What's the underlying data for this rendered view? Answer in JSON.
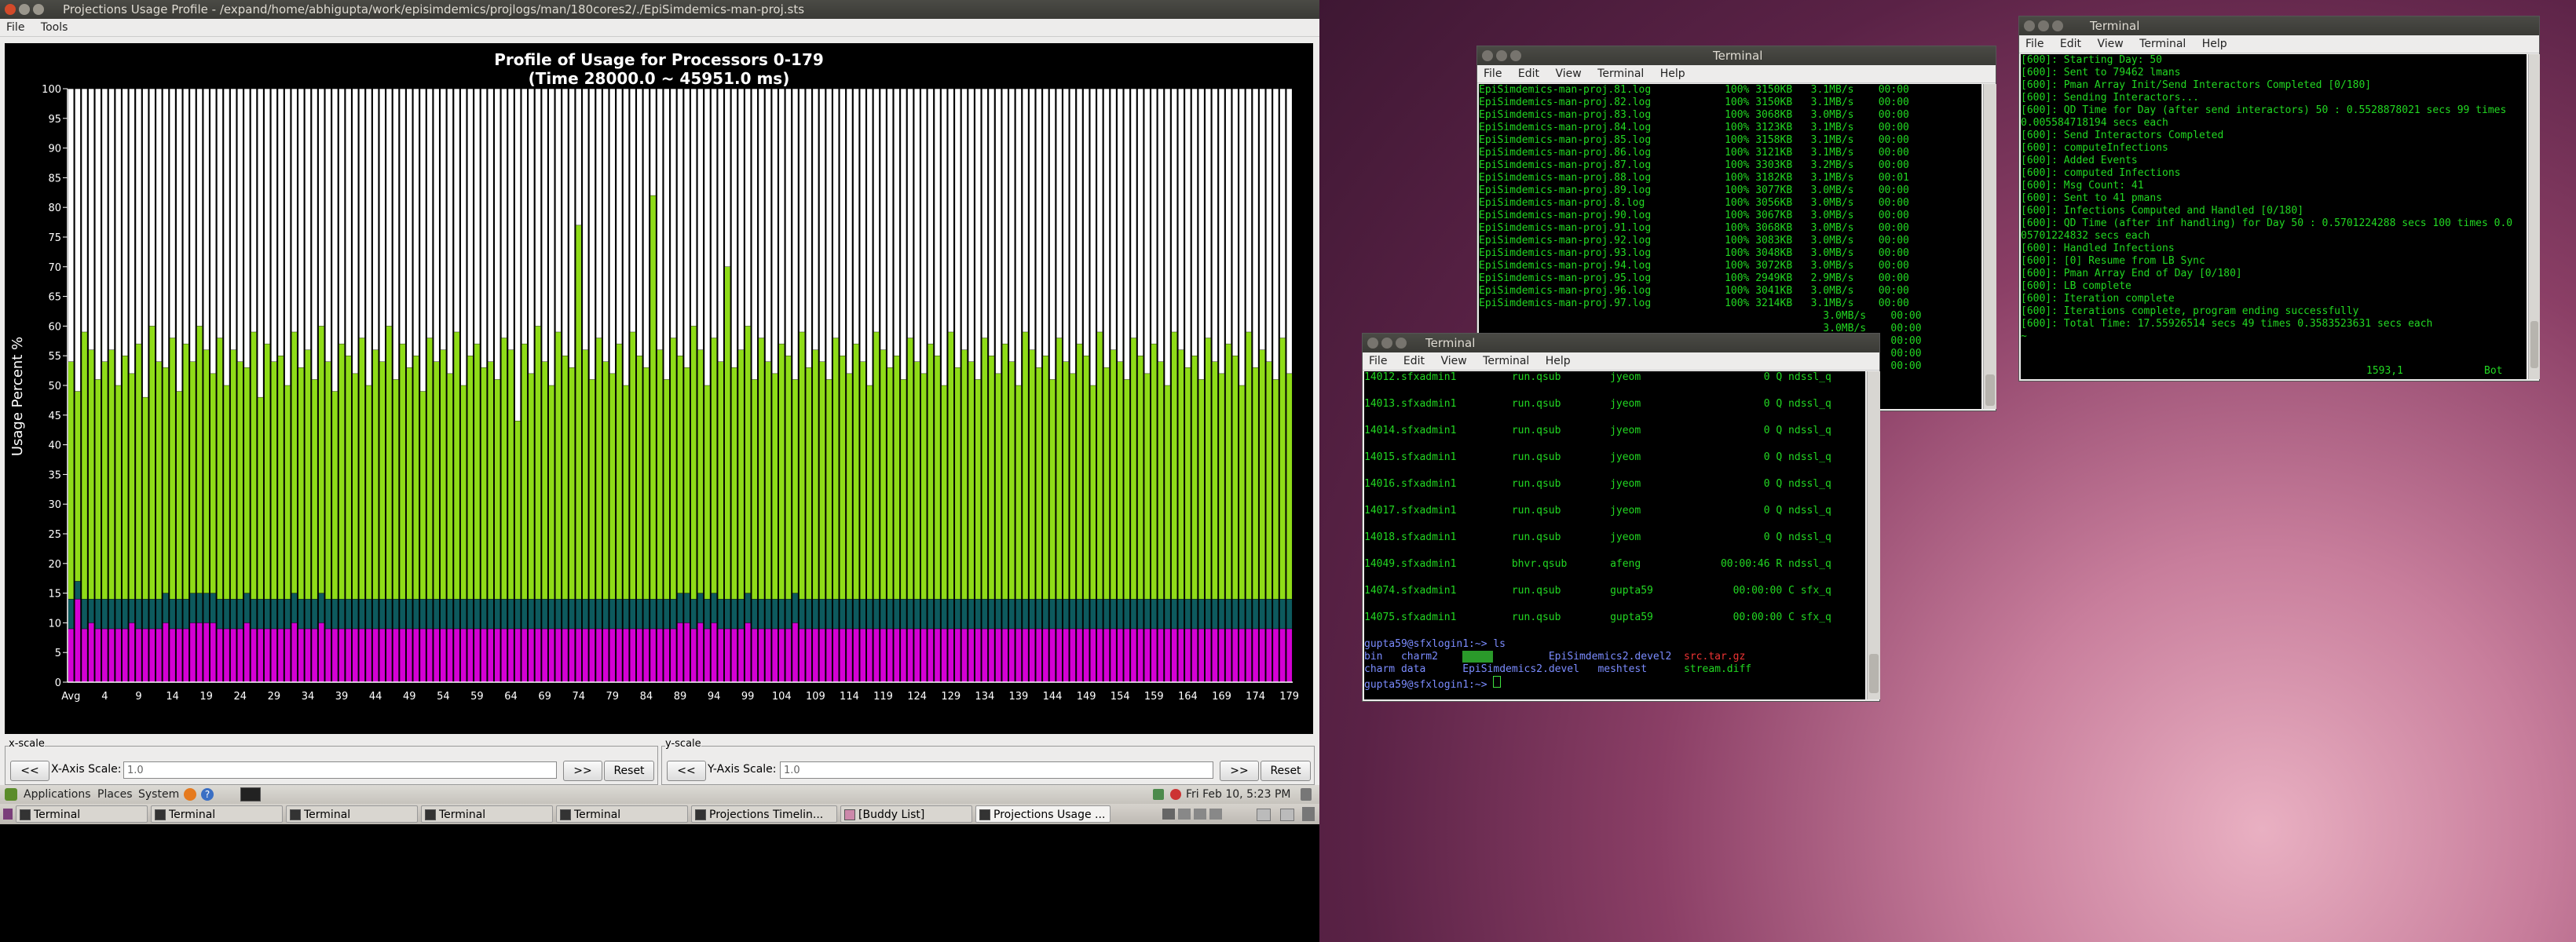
{
  "projections": {
    "title": "Projections Usage Profile - /expand/home/abhigupta/work/episimdemics/projlogs/man/180cores2/./EpiSimdemics-man-proj.sts",
    "menu": [
      "File",
      "Tools"
    ],
    "xscale": {
      "legend": "x-scale",
      "back": "<<",
      "label": "X-Axis Scale:",
      "value": "1.0",
      "fwd": ">>",
      "reset": "Reset"
    },
    "yscale": {
      "legend": "y-scale",
      "back": "<<",
      "label": "Y-Axis Scale:",
      "value": "1.0",
      "fwd": ">>",
      "reset": "Reset"
    }
  },
  "chart_data": {
    "type": "bar",
    "title": "Profile of Usage for Processors 0-179",
    "subtitle": "(Time 28000.0 ~ 45951.0 ms)",
    "ylabel": "Usage Percent %",
    "ylim": [
      0,
      100
    ],
    "yticks": [
      0,
      5,
      10,
      15,
      20,
      25,
      30,
      35,
      40,
      45,
      50,
      55,
      60,
      65,
      70,
      75,
      80,
      85,
      90,
      95,
      100
    ],
    "xtick_labels": [
      "Avg",
      "4",
      "9",
      "14",
      "19",
      "24",
      "29",
      "34",
      "39",
      "44",
      "49",
      "54",
      "59",
      "64",
      "69",
      "74",
      "79",
      "84",
      "89",
      "94",
      "99",
      "104",
      "109",
      "114",
      "119",
      "124",
      "129",
      "134",
      "139",
      "144",
      "149",
      "154",
      "159",
      "164",
      "169",
      "174",
      "179"
    ],
    "categories": [
      "Avg",
      "0",
      "1",
      "2",
      "3",
      "4",
      "5",
      "6",
      "7",
      "8",
      "9",
      "10",
      "11",
      "12",
      "13",
      "14",
      "15",
      "16",
      "17",
      "18",
      "19",
      "20",
      "21",
      "22",
      "23",
      "24",
      "25",
      "26",
      "27",
      "28",
      "29",
      "30",
      "31",
      "32",
      "33",
      "34",
      "35",
      "36",
      "37",
      "38",
      "39",
      "40",
      "41",
      "42",
      "43",
      "44",
      "45",
      "46",
      "47",
      "48",
      "49",
      "50",
      "51",
      "52",
      "53",
      "54",
      "55",
      "56",
      "57",
      "58",
      "59",
      "60",
      "61",
      "62",
      "63",
      "64",
      "65",
      "66",
      "67",
      "68",
      "69",
      "70",
      "71",
      "72",
      "73",
      "74",
      "75",
      "76",
      "77",
      "78",
      "79",
      "80",
      "81",
      "82",
      "83",
      "84",
      "85",
      "86",
      "87",
      "88",
      "89",
      "90",
      "91",
      "92",
      "93",
      "94",
      "95",
      "96",
      "97",
      "98",
      "99",
      "100",
      "101",
      "102",
      "103",
      "104",
      "105",
      "106",
      "107",
      "108",
      "109",
      "110",
      "111",
      "112",
      "113",
      "114",
      "115",
      "116",
      "117",
      "118",
      "119",
      "120",
      "121",
      "122",
      "123",
      "124",
      "125",
      "126",
      "127",
      "128",
      "129",
      "130",
      "131",
      "132",
      "133",
      "134",
      "135",
      "136",
      "137",
      "138",
      "139",
      "140",
      "141",
      "142",
      "143",
      "144",
      "145",
      "146",
      "147",
      "148",
      "149",
      "150",
      "151",
      "152",
      "153",
      "154",
      "155",
      "156",
      "157",
      "158",
      "159",
      "160",
      "161",
      "162",
      "163",
      "164",
      "165",
      "166",
      "167",
      "168",
      "169",
      "170",
      "171",
      "172",
      "173",
      "174",
      "175",
      "176",
      "177",
      "178",
      "179"
    ],
    "series_colors": {
      "magenta": "#d400d4",
      "teal": "#0d5a5e",
      "green": "#8fdc18",
      "idle": "#ffffff"
    },
    "series": [
      {
        "values": [
          9,
          14,
          9,
          10,
          9,
          9,
          9,
          9,
          9,
          10,
          9,
          9,
          9,
          9,
          10,
          9,
          9,
          9,
          10,
          10,
          10,
          10,
          9,
          9,
          9,
          9,
          10,
          9,
          9,
          9,
          9,
          9,
          9,
          10,
          9,
          9,
          9,
          10,
          9,
          9,
          9,
          9,
          9,
          9,
          9,
          9,
          9,
          9,
          9,
          9,
          9,
          9,
          9,
          9,
          9,
          9,
          9,
          9,
          9,
          9,
          9,
          9,
          9,
          9,
          9,
          9,
          9,
          9,
          9,
          9,
          9,
          9,
          9,
          9,
          9,
          9,
          9,
          9,
          9,
          9,
          9,
          9,
          9,
          9,
          9,
          9,
          9,
          9,
          9,
          9,
          10,
          10,
          9,
          10,
          9,
          10,
          9,
          9,
          9,
          9,
          10,
          9,
          9,
          9,
          9,
          9,
          9,
          10,
          9,
          9,
          9,
          9,
          9,
          9,
          9,
          9,
          9,
          9,
          9,
          9,
          9,
          9,
          9,
          9,
          9,
          9,
          9,
          9,
          9,
          9,
          9,
          9,
          9,
          9,
          9,
          9,
          9,
          9,
          9,
          9,
          9,
          9,
          9,
          9,
          9,
          9,
          9,
          9,
          9,
          9,
          9,
          9,
          9,
          9,
          9,
          9,
          9,
          9,
          9,
          9,
          9,
          9,
          9,
          9,
          9,
          9,
          9,
          9,
          9,
          9,
          9,
          9,
          9,
          9,
          9,
          9,
          9,
          9,
          9,
          9,
          9
        ]
      },
      {
        "values": [
          5,
          3,
          5,
          4,
          5,
          5,
          5,
          5,
          5,
          4,
          5,
          5,
          5,
          5,
          5,
          5,
          5,
          5,
          5,
          5,
          5,
          5,
          5,
          5,
          5,
          5,
          5,
          5,
          5,
          5,
          5,
          5,
          5,
          5,
          5,
          5,
          5,
          5,
          5,
          5,
          5,
          5,
          5,
          5,
          5,
          5,
          5,
          5,
          5,
          5,
          5,
          5,
          5,
          5,
          5,
          5,
          5,
          5,
          5,
          5,
          5,
          5,
          5,
          5,
          5,
          5,
          5,
          5,
          5,
          5,
          5,
          5,
          5,
          5,
          5,
          5,
          5,
          5,
          5,
          5,
          5,
          5,
          5,
          5,
          5,
          5,
          5,
          5,
          5,
          5,
          5,
          5,
          5,
          5,
          5,
          5,
          5,
          5,
          5,
          5,
          5,
          5,
          5,
          5,
          5,
          5,
          5,
          5,
          5,
          5,
          5,
          5,
          5,
          5,
          5,
          5,
          5,
          5,
          5,
          5,
          5,
          5,
          5,
          5,
          5,
          5,
          5,
          5,
          5,
          5,
          5,
          5,
          5,
          5,
          5,
          5,
          5,
          5,
          5,
          5,
          5,
          5,
          5,
          5,
          5,
          5,
          5,
          5,
          5,
          5,
          5,
          5,
          5,
          5,
          5,
          5,
          5,
          5,
          5,
          5,
          5,
          5,
          5,
          5,
          5,
          5,
          5,
          5,
          5,
          5,
          5,
          5,
          5,
          5,
          5,
          5,
          5,
          5,
          5,
          5,
          5
        ]
      },
      {
        "values": [
          40,
          32,
          45,
          42,
          37,
          40,
          42,
          36,
          41,
          38,
          43,
          34,
          46,
          40,
          38,
          44,
          35,
          43,
          39,
          45,
          41,
          37,
          44,
          36,
          42,
          40,
          38,
          45,
          34,
          43,
          40,
          41,
          36,
          44,
          39,
          42,
          37,
          45,
          40,
          35,
          43,
          41,
          38,
          44,
          36,
          42,
          40,
          46,
          37,
          43,
          39,
          41,
          35,
          44,
          40,
          42,
          38,
          45,
          36,
          41,
          43,
          39,
          40,
          37,
          44,
          42,
          30,
          43,
          38,
          46,
          40,
          36,
          45,
          41,
          39,
          63,
          42,
          37,
          44,
          40,
          38,
          43,
          36,
          45,
          41,
          39,
          68,
          42,
          37,
          44,
          40,
          38,
          46,
          41,
          36,
          43,
          40,
          56,
          39,
          42,
          45,
          37,
          44,
          40,
          38,
          43,
          41,
          36,
          45,
          39,
          42,
          40,
          37,
          44,
          41,
          38,
          43,
          40,
          36,
          45,
          42,
          39,
          41,
          37,
          44,
          40,
          38,
          43,
          41,
          36,
          45,
          39,
          42,
          40,
          37,
          44,
          41,
          38,
          43,
          40,
          36,
          45,
          42,
          39,
          41,
          37,
          44,
          40,
          38,
          43,
          41,
          36,
          45,
          39,
          42,
          40,
          37,
          44,
          41,
          38,
          43,
          40,
          36,
          45,
          42,
          39,
          41,
          37,
          44,
          40,
          38,
          43,
          41,
          36,
          45,
          39,
          42,
          40,
          37,
          44,
          38
        ]
      }
    ]
  },
  "terminal_top": {
    "title": "Terminal",
    "menu": [
      "File",
      "Edit",
      "View",
      "Terminal",
      "Help"
    ],
    "rows": [
      [
        "EpiSimdemics-man-proj.81.log",
        "100%",
        "3150KB",
        "3.1MB/s",
        "00:00"
      ],
      [
        "EpiSimdemics-man-proj.82.log",
        "100%",
        "3150KB",
        "3.1MB/s",
        "00:00"
      ],
      [
        "EpiSimdemics-man-proj.83.log",
        "100%",
        "3068KB",
        "3.0MB/s",
        "00:00"
      ],
      [
        "EpiSimdemics-man-proj.84.log",
        "100%",
        "3123KB",
        "3.1MB/s",
        "00:00"
      ],
      [
        "EpiSimdemics-man-proj.85.log",
        "100%",
        "3158KB",
        "3.1MB/s",
        "00:00"
      ],
      [
        "EpiSimdemics-man-proj.86.log",
        "100%",
        "3121KB",
        "3.1MB/s",
        "00:00"
      ],
      [
        "EpiSimdemics-man-proj.87.log",
        "100%",
        "3303KB",
        "3.2MB/s",
        "00:00"
      ],
      [
        "EpiSimdemics-man-proj.88.log",
        "100%",
        "3182KB",
        "3.1MB/s",
        "00:01"
      ],
      [
        "EpiSimdemics-man-proj.89.log",
        "100%",
        "3077KB",
        "3.0MB/s",
        "00:00"
      ],
      [
        "EpiSimdemics-man-proj.8.log",
        "100%",
        "3056KB",
        "3.0MB/s",
        "00:00"
      ],
      [
        "EpiSimdemics-man-proj.90.log",
        "100%",
        "3067KB",
        "3.0MB/s",
        "00:00"
      ],
      [
        "EpiSimdemics-man-proj.91.log",
        "100%",
        "3068KB",
        "3.0MB/s",
        "00:00"
      ],
      [
        "EpiSimdemics-man-proj.92.log",
        "100%",
        "3083KB",
        "3.0MB/s",
        "00:00"
      ],
      [
        "EpiSimdemics-man-proj.93.log",
        "100%",
        "3048KB",
        "3.0MB/s",
        "00:00"
      ],
      [
        "EpiSimdemics-man-proj.94.log",
        "100%",
        "3072KB",
        "3.0MB/s",
        "00:00"
      ],
      [
        "EpiSimdemics-man-proj.95.log",
        "100%",
        "2949KB",
        "2.9MB/s",
        "00:00"
      ],
      [
        "EpiSimdemics-man-proj.96.log",
        "100%",
        "3041KB",
        "3.0MB/s",
        "00:00"
      ],
      [
        "EpiSimdemics-man-proj.97.log",
        "100%",
        "3214KB",
        "3.1MB/s",
        "00:00"
      ]
    ],
    "partial_tail": [
      {
        "speed": "3.0MB/s",
        "time": "00:00"
      },
      {
        "speed": "3.0MB/s",
        "time": "00:00"
      },
      {
        "speed": "3.0MB/s",
        "time": "00:00"
      },
      {
        "speed": "3.0MB/s",
        "time": "00:00"
      },
      {
        "speed": "3.1MB/s",
        "time": "00:00"
      }
    ]
  },
  "terminal_right": {
    "title": "Terminal",
    "menu": [
      "File",
      "Edit",
      "View",
      "Terminal",
      "Help"
    ],
    "lines": [
      "[600]: Starting Day: 50",
      "[600]: Sent to 79462 lmans",
      "[600]: Pman Array Init/Send Interactors Completed [0/180]",
      "[600]: Sending Interactors...",
      "[600]: QD Time for Day (after send interactors) 50 : 0.5528878021 secs 99 times",
      "0.005584718194 secs each",
      "[600]: Send Interactors Completed",
      "[600]: computeInfections",
      "[600]: Added Events",
      "[600]: computed Infections",
      "[600]: Msg Count: 41",
      "[600]: Sent to 41 pmans",
      "[600]: Infections Computed and Handled [0/180]",
      "[600]: QD Time (after inf handling) for Day 50 : 0.5701224288 secs 100 times 0.0",
      "05701224832 secs each",
      "[600]: Handled Infections",
      "[600]: [0] Resume from LB Sync",
      "[600]: Pman Array End of Day [0/180]",
      "[600]: LB complete",
      "[600]: Iteration complete",
      "[600]: Iterations complete, program ending successfully",
      "[600]: Total Time: 17.55926514 secs 49 times 0.3583523631 secs each",
      "~"
    ],
    "status_pos": "1593,1",
    "status_scroll": "Bot"
  },
  "terminal_front": {
    "title": "Terminal",
    "menu": [
      "File",
      "Edit",
      "View",
      "Terminal",
      "Help"
    ],
    "jobs": [
      [
        "14012.sfxadmin1",
        "run.qsub",
        "jyeom",
        "0 Q ndssl_q"
      ],
      [
        "14013.sfxadmin1",
        "run.qsub",
        "jyeom",
        "0 Q ndssl_q"
      ],
      [
        "14014.sfxadmin1",
        "run.qsub",
        "jyeom",
        "0 Q ndssl_q"
      ],
      [
        "14015.sfxadmin1",
        "run.qsub",
        "jyeom",
        "0 Q ndssl_q"
      ],
      [
        "14016.sfxadmin1",
        "run.qsub",
        "jyeom",
        "0 Q ndssl_q"
      ],
      [
        "14017.sfxadmin1",
        "run.qsub",
        "jyeom",
        "0 Q ndssl_q"
      ],
      [
        "14018.sfxadmin1",
        "run.qsub",
        "jyeom",
        "0 Q ndssl_q"
      ],
      [
        "14049.sfxadmin1",
        "bhvr.qsub",
        "afeng",
        "00:00:46 R ndssl_q"
      ],
      [
        "14074.sfxadmin1",
        "run.qsub",
        "gupta59",
        "00:00:00 C sfx_q"
      ],
      [
        "14075.sfxadmin1",
        "run.qsub",
        "gupta59",
        "00:00:00 C sfx_q"
      ]
    ],
    "prompt_cmd": "gupta59@sfxlogin1:~> ls",
    "ls1": [
      "bin",
      "charm2",
      "",
      "EpiSimdemics2.devel2",
      "src.tar.gz"
    ],
    "ls2": [
      "charm",
      "data",
      "EpiSimdemics2.devel",
      "meshtest",
      "stream.diff"
    ],
    "prompt": "gupta59@sfxlogin1:~> "
  },
  "panel": {
    "menus": [
      "Applications",
      "Places",
      "System"
    ],
    "clock": "Fri Feb 10,  5:23 PM"
  },
  "taskbar": {
    "items": [
      "Terminal",
      "Terminal",
      "Terminal",
      "Terminal",
      "Terminal",
      "Projections Timelin...",
      "[Buddy List]",
      "Projections Usage ..."
    ]
  }
}
